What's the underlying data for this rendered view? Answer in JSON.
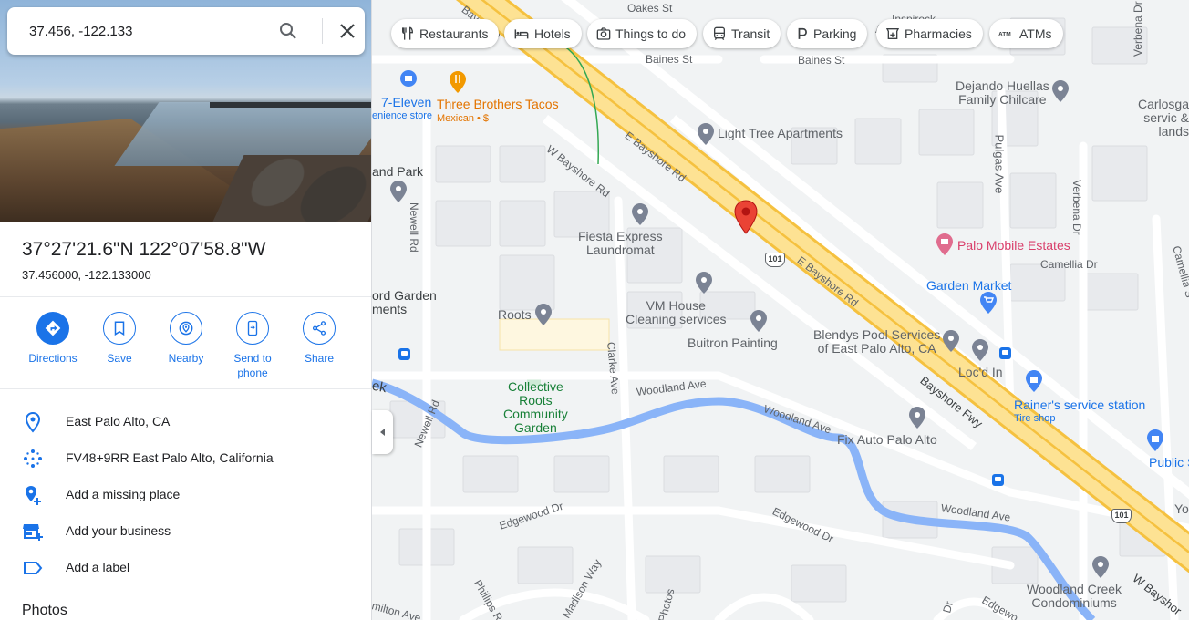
{
  "search": {
    "value": "37.456, -122.133"
  },
  "place": {
    "title": "37°27'21.6\"N 122°07'58.8\"W",
    "subtitle": "37.456000, -122.133000"
  },
  "actions": [
    {
      "label": "Directions",
      "icon": "directions-icon"
    },
    {
      "label": "Save",
      "icon": "bookmark-icon"
    },
    {
      "label": "Nearby",
      "icon": "nearby-icon"
    },
    {
      "label": "Send to\nphone",
      "icon": "send-to-phone-icon"
    },
    {
      "label": "Share",
      "icon": "share-icon"
    }
  ],
  "details": [
    {
      "text": "East Palo Alto, CA",
      "icon": "location-pin-icon"
    },
    {
      "text": "FV48+9RR East Palo Alto, California",
      "icon": "plus-code-icon"
    },
    {
      "text": "Add a missing place",
      "icon": "add-place-icon"
    },
    {
      "text": "Add your business",
      "icon": "add-business-icon"
    },
    {
      "text": "Add a label",
      "icon": "label-icon"
    }
  ],
  "photos_title": "Photos",
  "chips": [
    {
      "label": "Restaurants",
      "icon": "restaurant-icon"
    },
    {
      "label": "Hotels",
      "icon": "hotel-icon"
    },
    {
      "label": "Things to do",
      "icon": "camera-icon"
    },
    {
      "label": "Transit",
      "icon": "transit-icon"
    },
    {
      "label": "Parking",
      "icon": "parking-icon"
    },
    {
      "label": "Pharmacies",
      "icon": "pharmacy-icon"
    },
    {
      "label": "ATMs",
      "icon": "atm-icon"
    }
  ],
  "map": {
    "pois": [
      {
        "name": "Light Tree Apartments"
      },
      {
        "name": "Fiesta Express\nLaundromat"
      },
      {
        "name": "VM House\nCleaning services"
      },
      {
        "name": "Roots"
      },
      {
        "name": "Buitron Painting"
      },
      {
        "name": "Collective\nRoots\nCommunity\nGarden"
      },
      {
        "name": "Blendys Pool Services\nof East Palo Alto, CA"
      },
      {
        "name": "Loc'd In"
      },
      {
        "name": "Fix Auto Palo Alto"
      },
      {
        "name": "Dejando Huellas\nFamily Chilcare"
      },
      {
        "name": "Palo Mobile Estates"
      },
      {
        "name": "Garden Market"
      },
      {
        "name": "Rainer's service station"
      },
      {
        "name": "Tire shop"
      },
      {
        "name": "Woodland Creek\nCondominiums"
      },
      {
        "name": "Three Brothers Tacos"
      },
      {
        "name": "Mexican • $"
      },
      {
        "name": "7-Eleven"
      },
      {
        "name": "enience store"
      },
      {
        "name": "Public Sto"
      },
      {
        "name": "Carlosga\nservic & lands"
      },
      {
        "name": "Yo"
      }
    ],
    "streets": [
      "Oakes St",
      "Baines St",
      "Baines St",
      "E Bayshore Rd",
      "W Bayshore Rd",
      "E Bayshore Rd",
      "Bayshore Fwy",
      "Newell Rd",
      "Newell Rd",
      "Clarke Ave",
      "Woodland Ave",
      "Woodland Ave",
      "Woodland Ave",
      "Edgewood Dr",
      "Edgewood Dr",
      "Pulgas Ave",
      "Verbena Dr",
      "Verbena Dr",
      "Camellia Dr",
      "Camellia S",
      "Phillips Rd",
      "Madison Way",
      "Photos",
      "milton Ave",
      "Edgewo",
      "W Bayshor",
      "Inspirock",
      "Bayshore",
      "Dr",
      "Av"
    ],
    "areas": [
      "and Park",
      "ord Garden\nments",
      "ek"
    ],
    "shields": [
      "101",
      "101"
    ]
  }
}
